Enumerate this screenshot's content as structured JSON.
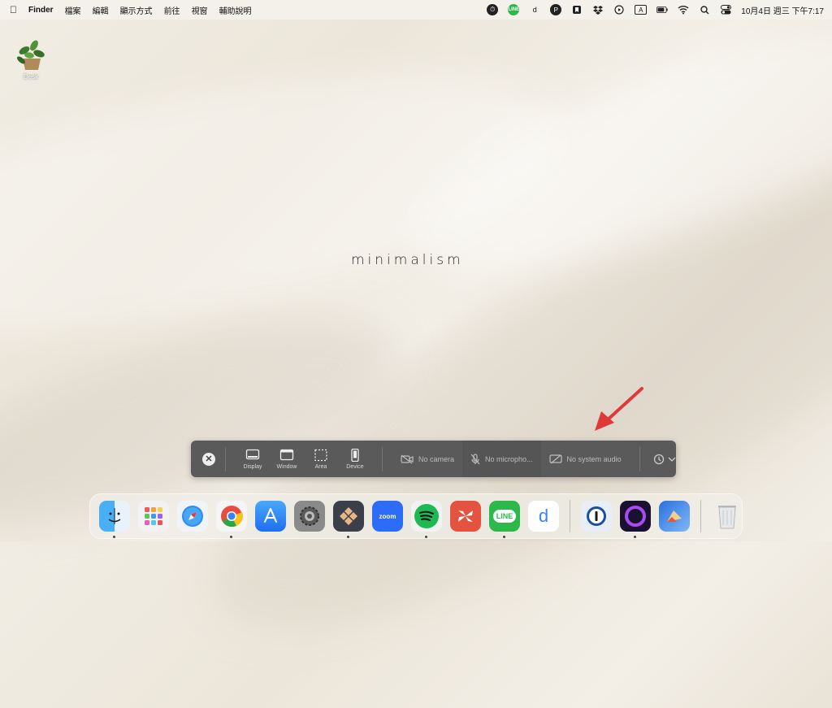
{
  "menubar": {
    "app_name": "Finder",
    "menus": [
      "檔案",
      "編輯",
      "顯示方式",
      "前往",
      "視窗",
      "輔助說明"
    ],
    "status_icons": [
      "screen-time-icon",
      "line-icon",
      "d-icon",
      "p-icon",
      "bookmark-icon",
      "dropbox-icon",
      "play-icon",
      "input-a-icon",
      "battery-icon",
      "wifi-icon",
      "search-icon",
      "control-center-icon"
    ],
    "line_badge": "LINE",
    "d_badge": "d",
    "input_badge": "A",
    "clock": "10月4日 週三  下午7:17"
  },
  "desktop": {
    "icon_label": "Desk",
    "wallpaper_text": "minimalism"
  },
  "capture_toolbar": {
    "modes": [
      {
        "label": "Display",
        "icon": "display-icon"
      },
      {
        "label": "Window",
        "icon": "window-icon"
      },
      {
        "label": "Area",
        "icon": "area-icon"
      },
      {
        "label": "Device",
        "icon": "device-icon"
      }
    ],
    "camera": "No camera",
    "microphone": "No micropho...",
    "system_audio": "No system audio"
  },
  "dock": {
    "apps": [
      {
        "name": "finder",
        "running": true
      },
      {
        "name": "launchpad",
        "running": false
      },
      {
        "name": "safari",
        "running": false
      },
      {
        "name": "chrome",
        "running": true
      },
      {
        "name": "app-store",
        "running": false
      },
      {
        "name": "system-settings",
        "running": false
      },
      {
        "name": "tool-app",
        "running": true
      },
      {
        "name": "zoom",
        "running": false
      },
      {
        "name": "spotify",
        "running": true
      },
      {
        "name": "pinwheel-app",
        "running": false
      },
      {
        "name": "line",
        "running": true
      },
      {
        "name": "dict-app",
        "running": false
      },
      {
        "name": "1password",
        "running": false
      },
      {
        "name": "screen-recorder",
        "running": true
      },
      {
        "name": "preview-app",
        "running": false
      },
      {
        "name": "trash",
        "running": false
      }
    ],
    "zoom_label": "zoom",
    "line_label": "LINE",
    "dict_label": "d"
  },
  "colors": {
    "toolbar_bg": "#5a5a5a",
    "arrow": "#e0393a",
    "line_green": "#2db84b",
    "zoom_blue": "#2d6cf6",
    "spotify_green": "#1db954"
  }
}
